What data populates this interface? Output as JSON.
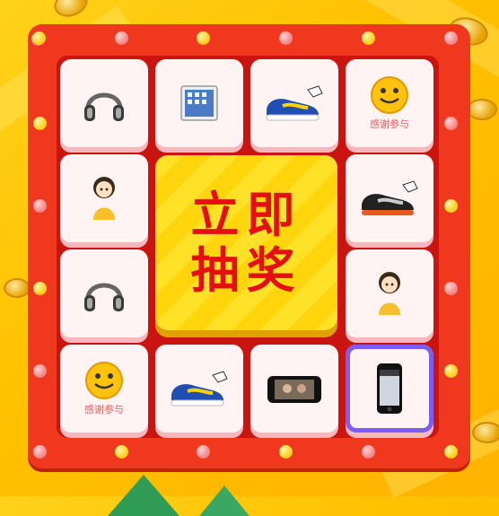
{
  "center": {
    "line1": "立即",
    "line2": "抽奖",
    "color": "#e41010"
  },
  "accent": {
    "frame": "#f0381f",
    "board": "#c91410",
    "selected": "#7b5cf6"
  },
  "prizes": [
    {
      "icon": "headphones-icon",
      "label": ""
    },
    {
      "icon": "ipad-icon",
      "label": ""
    },
    {
      "icon": "sneaker-icon",
      "label": ""
    },
    {
      "icon": "smiley-icon",
      "label": "感谢参与"
    },
    {
      "icon": "doll-icon",
      "label": ""
    },
    {
      "icon": "sneaker-black-icon",
      "label": ""
    },
    {
      "icon": "headphones-icon",
      "label": ""
    },
    {
      "icon": "doll-icon",
      "label": ""
    },
    {
      "icon": "smiley-icon",
      "label": "感谢参与"
    },
    {
      "icon": "sneaker-icon",
      "label": ""
    },
    {
      "icon": "iphone-landscape-icon",
      "label": ""
    },
    {
      "icon": "iphone-icon",
      "label": ""
    }
  ]
}
